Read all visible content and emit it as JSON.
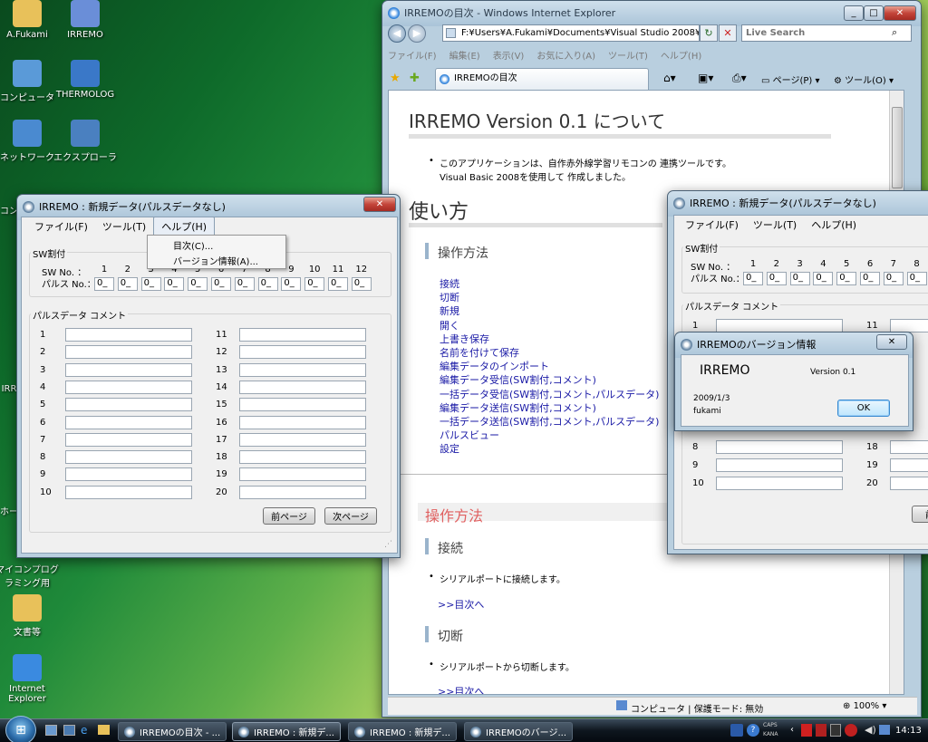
{
  "desktop": {
    "icons": [
      {
        "label": "A.Fukami",
        "icon": "folder-icon",
        "color": "#e8c15a"
      },
      {
        "label": "IRREMO",
        "icon": "gear-icon",
        "color": "#6a8ed8"
      },
      {
        "label": "コンピュータ",
        "icon": "computer-icon",
        "color": "#5a9ad8"
      },
      {
        "label": "THERMOLOG",
        "icon": "app-icon",
        "color": "#3a78c8"
      },
      {
        "label": "ネットワーク",
        "icon": "network-icon",
        "color": "#4a8ad0"
      },
      {
        "label": "エクスプローラ",
        "icon": "explorer-icon",
        "color": "#4a80c0"
      },
      {
        "label": "マイコンプログラミング用",
        "icon": "folder-icon",
        "color": "#e8c15a"
      },
      {
        "label": "文書等",
        "icon": "folder-icon",
        "color": "#e8c15a"
      },
      {
        "label": "Internet Explorer",
        "icon": "ie-icon",
        "color": "#3a8ae0"
      }
    ],
    "partial": {
      "com": "コン",
      "irr": "IRR",
      "ho": "ホー",
      "ko": "コン"
    }
  },
  "ie": {
    "title": "IRREMOの目次 - Windows Internet Explorer",
    "address": "F:¥Users¥A.Fukami¥Documents¥Visual Studio 2008¥",
    "search_placeholder": "Live Search",
    "menu": [
      "ファイル(F)",
      "編集(E)",
      "表示(V)",
      "お気に入り(A)",
      "ツール(T)",
      "ヘルプ(H)"
    ],
    "tab": "IRREMOの目次",
    "cmd_page": "ページ(P)",
    "cmd_tools": "ツール(O)",
    "status": "コンピュータ | 保護モード: 無効",
    "zoom": "100%"
  },
  "doc": {
    "h1": "IRREMO Version 0.1 について",
    "intro_line1": "このアプリケーションは、自作赤外線学習リモコンの 連携ツールです。",
    "intro_line2": "Visual Basic 2008を使用して 作成しました。",
    "h2": "使い方",
    "h3": "操作方法",
    "links": [
      "接続",
      "切断",
      "新規",
      "開く",
      "上書き保存",
      "名前を付けて保存",
      "編集データのインポート",
      "編集データ受信(SW割付,コメント)",
      "一括データ受信(SW割付,コメント,パルスデータ)",
      "編集データ送信(SW割付,コメント)",
      "一括データ送信(SW割付,コメント,パルスデータ)",
      "パルスビュー",
      "設定"
    ],
    "section_title": "操作方法",
    "s1_title": "接続",
    "s1_text": "シリアルポートに接続します。",
    "back": ">>目次へ",
    "s2_title": "切断",
    "s2_text": "シリアルポートから切断します。"
  },
  "irremo": {
    "title": "IRREMO : 新規データ(パルスデータなし)",
    "menu": [
      "ファイル(F)",
      "ツール(T)",
      "ヘルプ(H)"
    ],
    "help_items": [
      "目次(C)...",
      "バージョン情報(A)..."
    ],
    "sw_group": "SW割付",
    "sw_no": "SW No. ：",
    "pulse_no": "パルス No.：",
    "sw_numbers": [
      "1",
      "2",
      "3",
      "4",
      "5",
      "6",
      "7",
      "8",
      "9",
      "10",
      "11",
      "12"
    ],
    "pulse_value": "0_",
    "comment_group": "パルスデータ コメント",
    "rows_left": [
      "1",
      "2",
      "3",
      "4",
      "5",
      "6",
      "7",
      "8",
      "9",
      "10"
    ],
    "rows_right": [
      "11",
      "12",
      "13",
      "14",
      "15",
      "16",
      "17",
      "18",
      "19",
      "20"
    ],
    "prev": "前ページ",
    "next": "次ページ"
  },
  "irremo2": {
    "title": "IRREMO : 新規データ(パルスデータなし)",
    "menu": [
      "ファイル(F)",
      "ツール(T)",
      "ヘルプ(H)"
    ],
    "sw_group": "SW割付",
    "sw_no": "SW No. ：",
    "pulse_no": "パルス No.：",
    "sw_numbers": [
      "1",
      "2",
      "3",
      "4",
      "5",
      "6",
      "7",
      "8"
    ],
    "pulse_value": "0_",
    "comment_group": "パルスデータ コメント",
    "rows_left": [
      "1",
      "8",
      "9",
      "10"
    ],
    "rows_right": [
      "11",
      "18",
      "19",
      "20"
    ]
  },
  "about": {
    "title": "IRREMOのバージョン情報",
    "app": "IRREMO",
    "version": "Version 0.1",
    "date": "2009/1/3",
    "author": "fukami",
    "ok": "OK"
  },
  "taskbar": {
    "items": [
      "IRREMOの目次 - ...",
      "IRREMO : 新規デ...",
      "IRREMO : 新規デ...",
      "IRREMOのバージ..."
    ],
    "time": "14:13",
    "caps": "CAPS",
    "kana": "KANA"
  }
}
